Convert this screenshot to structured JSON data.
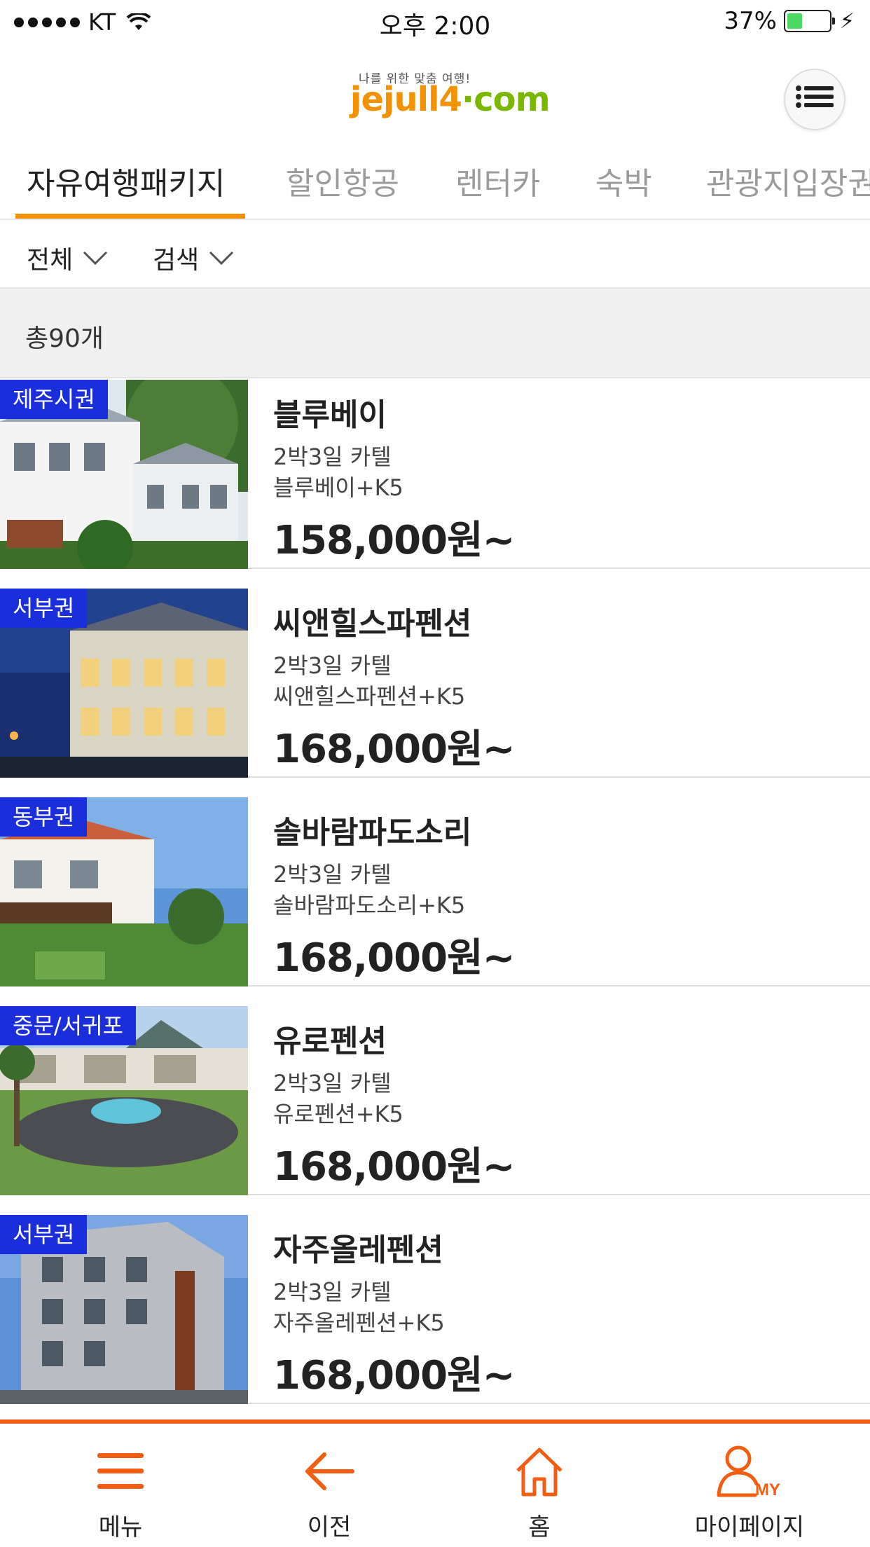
{
  "status_bar": {
    "carrier": "KT",
    "time": "오후 2:00",
    "battery": "37%",
    "battery_level": 0.37
  },
  "header": {
    "logo_tagline": "나를 위한 맞춤 여행!",
    "logo_text_a": "jejull4",
    "logo_text_b": "·com",
    "menu_icon": "list-icon"
  },
  "tabs": [
    {
      "label": "자유여행패키지",
      "active": true
    },
    {
      "label": "할인항공",
      "active": false
    },
    {
      "label": "렌터카",
      "active": false
    },
    {
      "label": "숙박",
      "active": false
    },
    {
      "label": "관광지입장권",
      "active": false
    }
  ],
  "filters": [
    {
      "label": "전체"
    },
    {
      "label": "검색"
    }
  ],
  "count_label": "총90개",
  "items": [
    {
      "region": "제주시권",
      "name": "블루베이",
      "duration": "2박3일 카텔",
      "detail": "블루베이+K5",
      "price": "158,000원~"
    },
    {
      "region": "서부권",
      "name": "씨앤힐스파펜션",
      "duration": "2박3일 카텔",
      "detail": "씨앤힐스파펜션+K5",
      "price": "168,000원~"
    },
    {
      "region": "동부권",
      "name": "솔바람파도소리",
      "duration": "2박3일 카텔",
      "detail": "솔바람파도소리+K5",
      "price": "168,000원~"
    },
    {
      "region": "중문/서귀포",
      "name": "유로펜션",
      "duration": "2박3일 카텔",
      "detail": "유로펜션+K5",
      "price": "168,000원~"
    },
    {
      "region": "서부권",
      "name": "자주올레펜션",
      "duration": "2박3일 카텔",
      "detail": "자주올레펜션+K5",
      "price": "168,000원~"
    }
  ],
  "bottom_nav": [
    {
      "label": "메뉴",
      "icon": "hamburger-icon"
    },
    {
      "label": "이전",
      "icon": "arrow-left-icon"
    },
    {
      "label": "홈",
      "icon": "home-icon"
    },
    {
      "label": "마이페이지",
      "icon": "user-my-icon"
    }
  ],
  "colors": {
    "accent": "#f39200",
    "nav_accent": "#f25d12",
    "region_badge": "#1a2edb",
    "logo_green": "#7ab800"
  }
}
